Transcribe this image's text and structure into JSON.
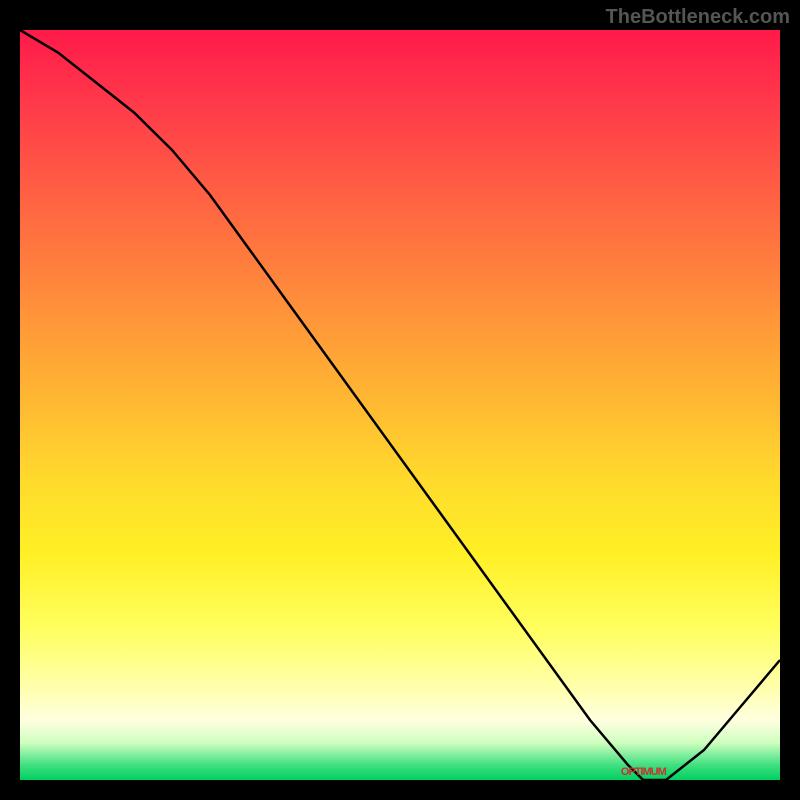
{
  "watermark": "TheBottleneck.com",
  "chart_data": {
    "type": "line",
    "title": "",
    "xlabel": "",
    "ylabel": "",
    "xlim": [
      0,
      100
    ],
    "ylim": [
      0,
      100
    ],
    "x": [
      0,
      5,
      10,
      15,
      20,
      25,
      30,
      35,
      40,
      45,
      50,
      55,
      60,
      65,
      70,
      75,
      80,
      82,
      85,
      90,
      95,
      100
    ],
    "values": [
      100,
      97,
      93,
      89,
      84,
      78,
      71,
      64,
      57,
      50,
      43,
      36,
      29,
      22,
      15,
      8,
      2,
      0,
      0,
      4,
      10,
      16
    ],
    "gradient_stops": [
      {
        "pos": 0.0,
        "color": "#ff1a4a"
      },
      {
        "pos": 0.5,
        "color": "#ffba32"
      },
      {
        "pos": 0.8,
        "color": "#ffff60"
      },
      {
        "pos": 0.95,
        "color": "#d0ffc0"
      },
      {
        "pos": 1.0,
        "color": "#00d060"
      }
    ],
    "marker_label": "OPTIMUM",
    "marker_x": 83
  }
}
